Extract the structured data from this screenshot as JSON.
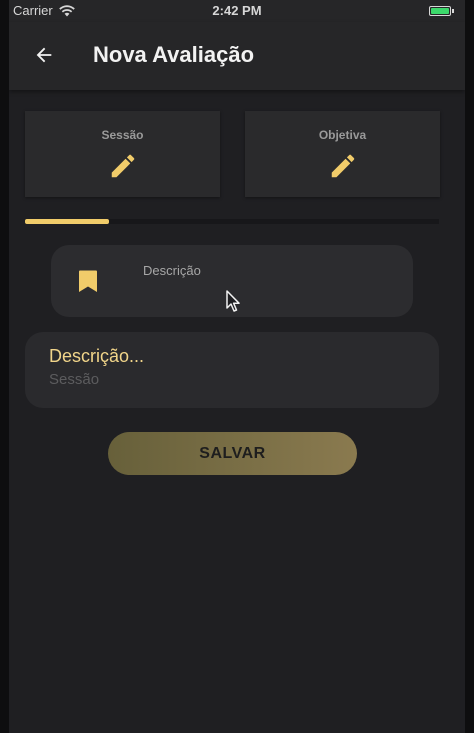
{
  "status_bar": {
    "carrier": "Carrier",
    "time": "2:42 PM",
    "wifi_icon": "wifi-icon",
    "battery_icon": "battery-icon"
  },
  "app_bar": {
    "back_icon": "arrow-left-icon",
    "title": "Nova Avaliação"
  },
  "tabs": [
    {
      "label": "Sessão",
      "icon": "pencil-icon"
    },
    {
      "label": "Objetiva",
      "icon": "pencil-icon"
    }
  ],
  "tab_indicator": {
    "active_index": 0,
    "color": "#f1cc6a"
  },
  "select": {
    "label": "Descrição",
    "icon": "bookmark-icon"
  },
  "item": {
    "title": "Descrição...",
    "subtitle": "Sessão"
  },
  "save_button": {
    "label": "SALVAR"
  },
  "colors": {
    "accent": "#f1cc6a",
    "background": "#1f1f22",
    "surface": "#2a2a2c"
  }
}
